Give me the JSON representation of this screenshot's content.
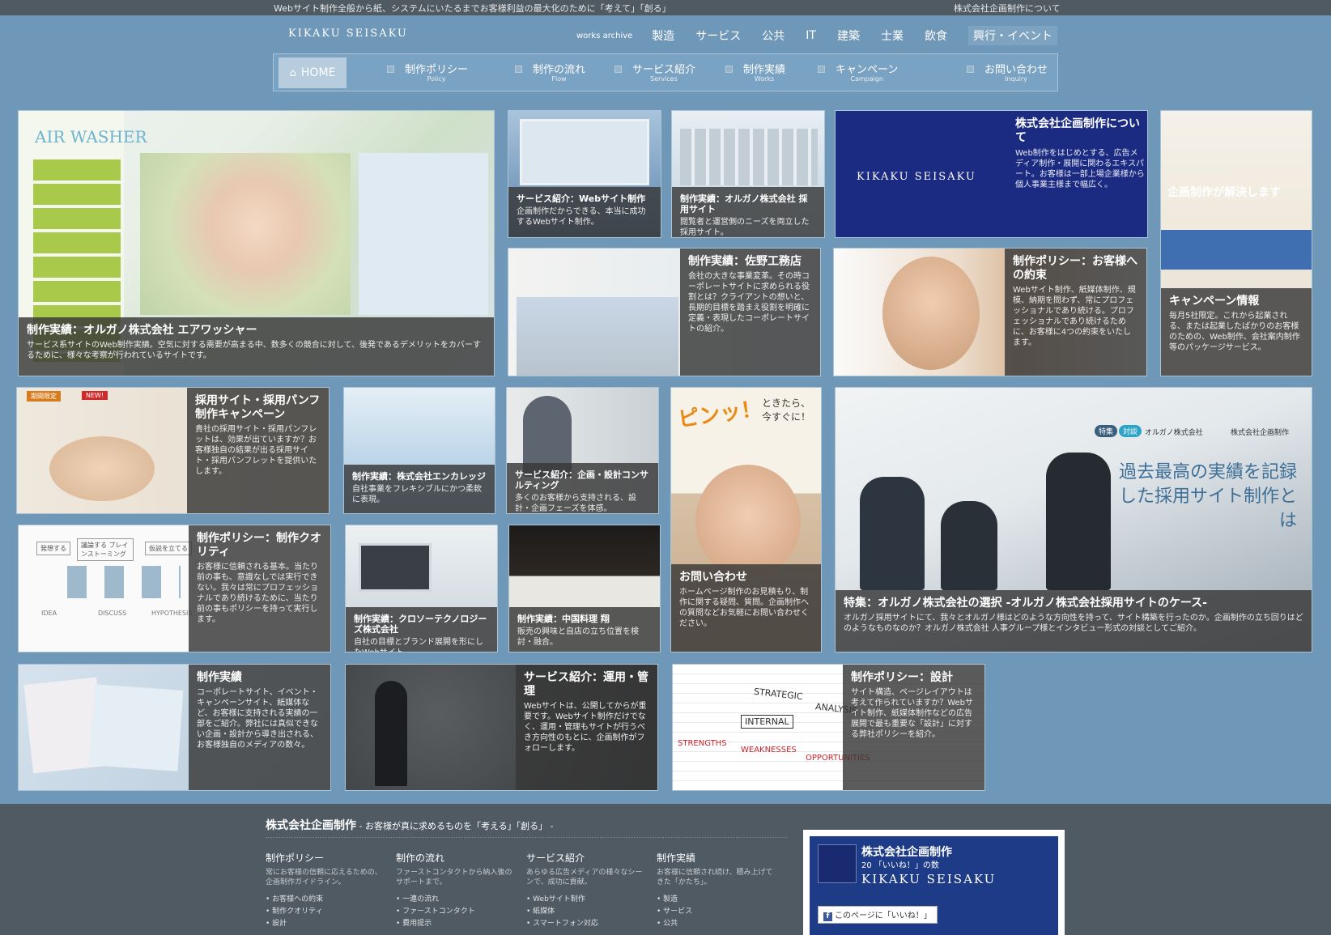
{
  "topbar": {
    "tagline": "Webサイト制作全般から紙、システムにいたるまでお客様利益の最大化のために「考えて」「創る」",
    "about_link": "株式会社企画制作について"
  },
  "header": {
    "logo": "KIKAKU SEISAKU",
    "categories": [
      "works archive",
      "製造",
      "サービス",
      "公共",
      "IT",
      "建築",
      "士業",
      "飲食",
      "興行・イベント"
    ]
  },
  "nav": {
    "home": "HOME",
    "items": [
      {
        "jp": "制作ポリシー",
        "en": "Policy"
      },
      {
        "jp": "制作の流れ",
        "en": "Flow"
      },
      {
        "jp": "サービス紹介",
        "en": "Services"
      },
      {
        "jp": "制作実績",
        "en": "Works"
      },
      {
        "jp": "キャンペーン",
        "en": "Campaign"
      },
      {
        "jp": "お問い合わせ",
        "en": "Inquiry"
      }
    ]
  },
  "tiles": {
    "airwasher": {
      "title": "制作実績：オルガノ株式会社 エアワッシャー",
      "text": "サービス系サイトのWeb制作実績。空気に対する需要が高まる中、数多くの競合に対して、後発であるデメリットをカバーするために、様々な考察が行われているサイトです。",
      "img_text": "AIR WASHER"
    },
    "web": {
      "title": "サービス紹介：Webサイト制作",
      "text": "企画制作だからできる、本当に成功するWebサイト制作。"
    },
    "recruit": {
      "title": "制作実績：オルガノ株式会社 採用サイト",
      "text": "閲覧者と運営側のニーズを両立した採用サイト。"
    },
    "about": {
      "logo": "KIKAKU SEISAKU",
      "title": "株式会社企画制作について",
      "text": "Web制作をはじめとする、広告メディア制作・展開に関わるエキスパート。お客様は一部上場企業様から個人事業主様まで幅広く。"
    },
    "campaign_info": {
      "title": "キャンペーン情報",
      "text": "毎月5社限定。これから起業される、または起業したばかりのお客様のための、Web制作、会社案内制作等のパッケージサービス。",
      "img_text": "企画制作が解決します"
    },
    "sano": {
      "title": "制作実績：佐野工務店",
      "text": "会社の大きな事業変革。その時コーポレートサイトに求められる役割とは？クライアントの想いと、長期的目標を踏まえ役割を明確に定義・表現したコーポレートサイトの紹介。"
    },
    "promise": {
      "title": "制作ポリシー：お客様への約束",
      "text": "Webサイト制作、紙媒体制作、規模、納期を問わず、常にプロフェッショナルであり続ける。プロフェッショナルであり続けるために、お客様に4つの約束をいたします。"
    },
    "recruit_campaign": {
      "title": "採用サイト・採用パンフ制作キャンペーン",
      "text": "貴社の採用サイト・採用パンフレットは、効果が出ていますか？お客様独自の結果が出る採用サイト・採用パンフレットを提供いたします。",
      "badge1": "期間限定",
      "badge2": "NEW!"
    },
    "encolledge": {
      "title": "制作実績：株式会社エンカレッジ",
      "text": "自社事業をフレキシブルにかつ柔軟に表現。"
    },
    "consulting": {
      "title": "サービス紹介：企画・設計コンサルティング",
      "text": "多くのお客様から支持される、設計・企画フェーズを体感。"
    },
    "inquiry": {
      "title": "お問い合わせ",
      "text": "ホームページ制作のお見積もり、制作に関する疑問、質問。企画制作への質問などお気軽にお問い合わせください。",
      "img_text": "ピンッ！",
      "img_text2": "ときたら、今すぐに！"
    },
    "feature": {
      "title": "特集：オルガノ株式会社の選択 -オルガノ株式会社採用サイトのケース-",
      "text": "オルガノ採用サイトにて、我々とオルガノ様はどのような方向性を持って、サイト構築を行ったのか。企画制作の立ち回りはどのようなものなのか？オルガノ株式会社 人事グループ様とインタビュー形式の対談としてご紹介。",
      "headline": "過去最高の実績を記録した採用サイト制作とは",
      "tag1": "特集",
      "tag2": "対談",
      "company1": "オルガノ株式会社",
      "company2": "株式会社企画制作"
    },
    "quality": {
      "title": "制作ポリシー：制作クオリティ",
      "text": "お客様に信頼される基本。当たり前の事も、意識なしでは実行できない。我々は常にプロフェッショナルであり続けるために、当たり前の事もポリシーを持って実行します。",
      "img_labels": [
        "発想する",
        "議論する ブレインストーミング",
        "仮説を立てる",
        "IDEA",
        "DISCUSS",
        "HYPOTHESIS"
      ]
    },
    "crosso": {
      "title": "制作実績：クロソーテクノロジーズ株式会社",
      "text": "自社の目標とブランド展開を形にしたWebサイト。"
    },
    "chugoku": {
      "title": "制作実績：中国料理 翔",
      "text": "販売の興味と自店の立ち位置を検討・融合。"
    },
    "works": {
      "title": "制作実績",
      "text": "コーポレートサイト、イベント・キャンペーンサイト、紙媒体など、お客様に支持される実績の一部をご紹介。弊社には真似できない企画・設計から導き出される、お客様独自のメディアの数々。"
    },
    "operation": {
      "title": "サービス紹介：運用・管理",
      "text": "Webサイトは、公開してからが重要です。Webサイト制作だけでなく、運用・管理もサイトが行うべき方向性のもとに、企画制作がフォローします。"
    },
    "design": {
      "title": "制作ポリシー：設計",
      "text": "サイト構造、ページレイアウトは考えて作られていますか？Webサイト制作、紙媒体制作などの広告展開で最も重要な「設計」に対する弊社ポリシーを紹介。",
      "img_words": [
        "STRATEGIC",
        "ANALYSIS",
        "INTERNAL",
        "STRENGTHS",
        "WEAKNESSES",
        "OPPORTUNITIES"
      ]
    }
  },
  "footer": {
    "company": "株式会社企画制作",
    "tagline": " - お客様が真に求めるものを「考える」「創る」 -",
    "columns": [
      {
        "title": "制作ポリシー",
        "desc": "常にお客様の信頼に応えるための、企画制作ガイドライン。",
        "links": [
          "お客様への約束",
          "制作クオリティ",
          "設計"
        ]
      },
      {
        "title": "制作の流れ",
        "desc": "ファーストコンタクトから納入後のサポートまで。",
        "links": [
          "一連の流れ",
          "ファーストコンタクト",
          "費用提示"
        ]
      },
      {
        "title": "サービス紹介",
        "desc": "あらゆる広告メディアの様々なシーンで、成功に貢献。",
        "links": [
          "Webサイト制作",
          "紙媒体",
          "スマートフォン対応"
        ]
      },
      {
        "title": "制作実績",
        "desc": "お客様に信頼され続け、積み上げてきた「かたち」。",
        "links": [
          "製造",
          "サービス",
          "公共"
        ]
      }
    ],
    "facebook": {
      "name": "株式会社企画制作",
      "likes": "20 「いいね！」の数",
      "logo": "KIKAKU SEISAKU",
      "like_button": "このページに「いいね！」"
    }
  }
}
